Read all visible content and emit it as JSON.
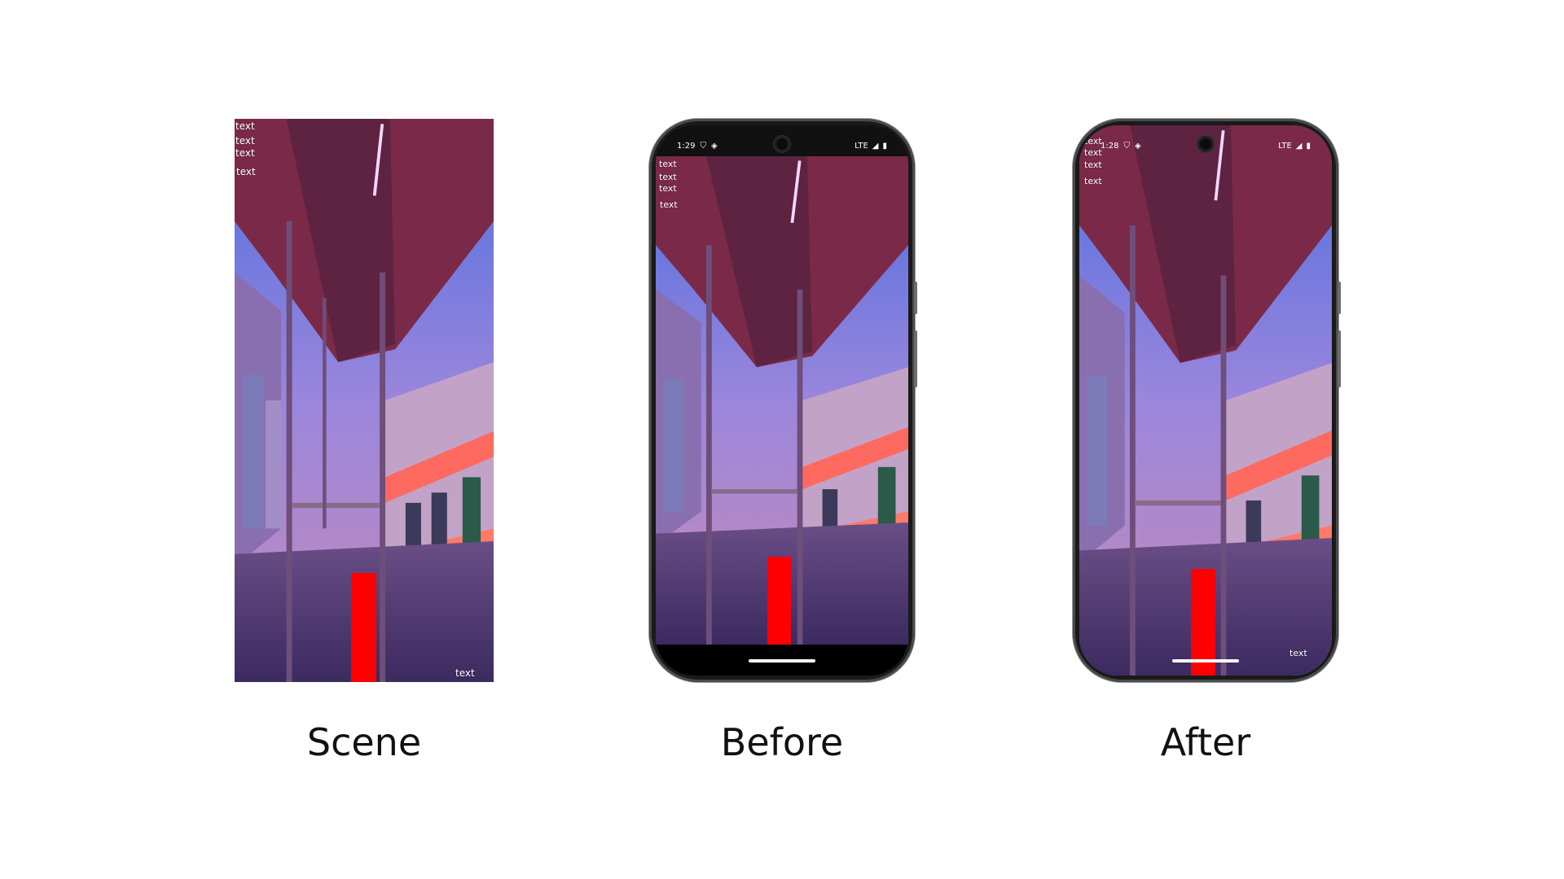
{
  "captions": {
    "scene": "Scene",
    "before": "Before",
    "after": "After"
  },
  "overlay": {
    "top_labels": [
      "text",
      "text",
      "text",
      "text"
    ],
    "bottom_label": "text"
  },
  "before_phone": {
    "status_time": "1:29",
    "status_network": "LTE"
  },
  "after_phone": {
    "status_time": "1:28",
    "status_network": "LTE"
  },
  "colors": {
    "bar": "#ff0000",
    "sky": "#5a7fe0",
    "roof": "#7a2a48",
    "train_stripe": "#ff6a60",
    "background": "#ffffff"
  },
  "icons": [
    "shield-icon",
    "signal-icon",
    "battery-icon",
    "camera-icon"
  ]
}
